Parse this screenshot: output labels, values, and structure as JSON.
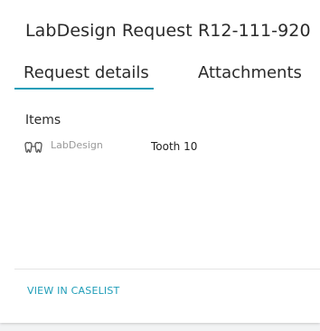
{
  "header": {
    "title": "LabDesign Request R12-111-920"
  },
  "tabs": [
    {
      "label": "Request details",
      "active": true
    },
    {
      "label": "Attachments",
      "active": false
    }
  ],
  "items_section": {
    "label": "Items",
    "items": [
      {
        "icon": "tooth-icon",
        "vendor": "LabDesign",
        "value": "Tooth 10"
      }
    ]
  },
  "footer": {
    "link_label": "VIEW IN CASELIST"
  },
  "colors": {
    "accent": "#1f9db8",
    "text": "#2a2a2a",
    "muted": "#9a9a9a"
  }
}
